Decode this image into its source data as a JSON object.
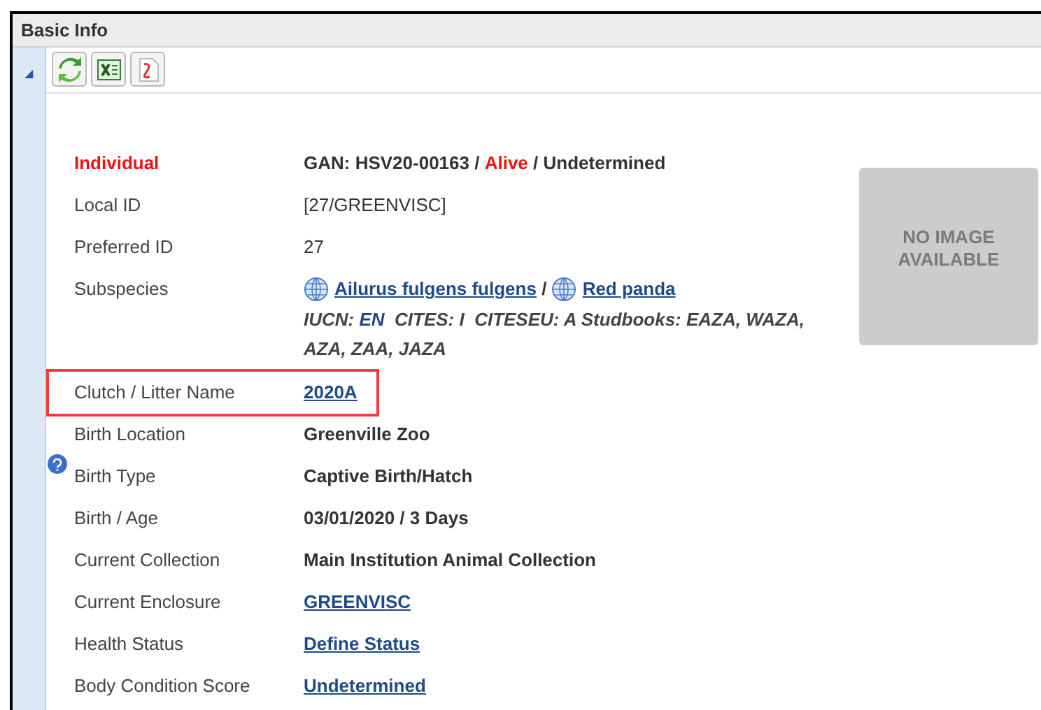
{
  "panel": {
    "title": "Basic Info",
    "collapse": "◢"
  },
  "toolbar": [
    {
      "kind": "refresh"
    },
    {
      "kind": "excel"
    },
    {
      "kind": "pdf"
    }
  ],
  "photo": {
    "text": "NO IMAGE AVAILABLE"
  },
  "rows": [
    {
      "label": "Individual",
      "emphasized": true,
      "values": [
        {
          "text": "GAN: HSV20-00163",
          "kind": "bold"
        },
        {
          "text": " / ",
          "kind": "bold"
        },
        {
          "text": "Alive",
          "kind": "red"
        },
        {
          "text": " / Undetermined",
          "kind": "bold"
        }
      ]
    },
    {
      "label": "Local ID",
      "values": [
        {
          "text": "[27/GREENVISC]",
          "kind": "plain"
        }
      ]
    },
    {
      "label": "Preferred ID",
      "values": [
        {
          "text": "27",
          "kind": "plain"
        }
      ]
    },
    {
      "label": "Subspecies",
      "values": [
        {
          "text": "Ailurus fulgens fulgens",
          "kind": "globe-link"
        },
        {
          "text": " / ",
          "kind": "bold"
        },
        {
          "text": "Red panda",
          "kind": "globe-link"
        }
      ],
      "note": [
        {
          "text": "IUCN: ",
          "kind": "italic"
        },
        {
          "text": "EN",
          "kind": "blue"
        },
        {
          "text": "  CITES: I  CITESEU: A Studbooks: EAZA, WAZA, AZA, ZAA, JAZA",
          "kind": "italic"
        }
      ]
    },
    {
      "label": "Clutch / Litter Name",
      "highlighted": true,
      "values": [
        {
          "text": "2020A",
          "kind": "link"
        }
      ]
    },
    {
      "label": "Birth Location",
      "values": [
        {
          "text": "Greenville Zoo",
          "kind": "bold"
        }
      ]
    },
    {
      "label": "Birth Type",
      "help": true,
      "values": [
        {
          "text": "Captive Birth/Hatch",
          "kind": "bold"
        }
      ]
    },
    {
      "label": "Birth / Age",
      "values": [
        {
          "text": "03/01/2020 / 3 Days",
          "kind": "bold"
        }
      ]
    },
    {
      "label": "Current Collection",
      "values": [
        {
          "text": "Main Institution Animal Collection",
          "kind": "bold"
        }
      ]
    },
    {
      "label": "Current Enclosure",
      "values": [
        {
          "text": "GREENVISC",
          "kind": "link"
        }
      ]
    },
    {
      "label": "Health Status",
      "values": [
        {
          "text": "Define Status",
          "kind": "link"
        }
      ]
    },
    {
      "label": "Body Condition Score",
      "values": [
        {
          "text": "Undetermined",
          "kind": "link"
        }
      ]
    }
  ]
}
